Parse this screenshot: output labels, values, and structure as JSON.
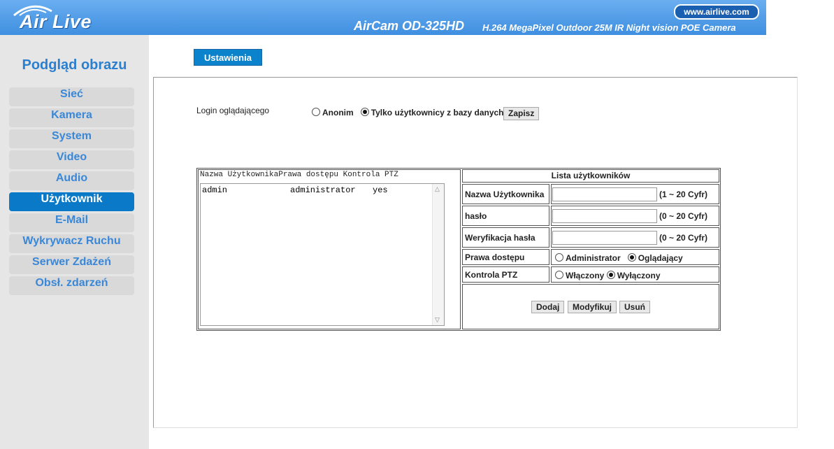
{
  "header": {
    "brand": "Air Live",
    "website": "www.airlive.com",
    "model": "AirCam OD-325HD",
    "tagline": "H.264 MegaPixel Outdoor 25M IR Night vision POE Camera"
  },
  "sidebar": {
    "title": "Podgląd obrazu",
    "items": [
      {
        "label": "Sieć"
      },
      {
        "label": "Kamera"
      },
      {
        "label": "System"
      },
      {
        "label": "Video"
      },
      {
        "label": "Audio"
      },
      {
        "label": "Użytkownik"
      },
      {
        "label": "E-Mail"
      },
      {
        "label": "Wykrywacz Ruchu"
      },
      {
        "label": "Serwer Zdażeń"
      },
      {
        "label": "Obsł. zdarzeń"
      }
    ],
    "active_index": 5
  },
  "tab": {
    "label": "Ustawienia"
  },
  "login": {
    "label": "Login oglądającego",
    "option_anon": "Anonim",
    "option_db": "Tylko użytkownicy z bazy danych",
    "selected": "db",
    "save_label": "Zapisz"
  },
  "user_list": {
    "header": "Nazwa UżytkownikaPrawa dostępu Kontrola PTZ",
    "rows": [
      {
        "name": "admin",
        "rights": "administrator",
        "ptz": "yes"
      }
    ]
  },
  "user_form": {
    "title": "Lista użytkowników",
    "username_label": "Nazwa Użytkownika",
    "username_hint": "(1 ~ 20 Cyfr)",
    "username_value": "",
    "password_label": "hasło",
    "password_hint": "(0 ~ 20 Cyfr)",
    "verify_label": "Weryfikacja hasła",
    "verify_hint": "(0 ~ 20 Cyfr)",
    "rights_label": "Prawa dostępu",
    "rights_admin": "Administrator",
    "rights_viewer": "Oglądający",
    "rights_selected": "viewer",
    "ptz_label": "Kontrola PTZ",
    "ptz_on": "Włączony",
    "ptz_off": "Wyłączony",
    "ptz_selected": "off",
    "add_label": "Dodaj",
    "modify_label": "Modyfikuj",
    "delete_label": "Usuń"
  }
}
